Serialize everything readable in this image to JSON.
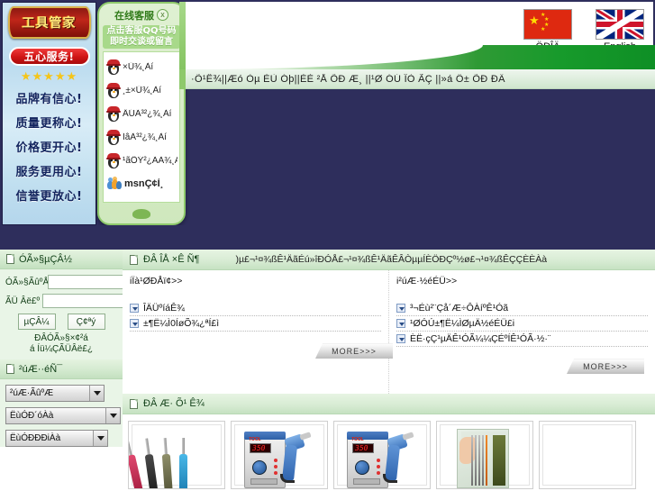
{
  "left_banner": {
    "logo_text": "工具管家",
    "badge_text": "五心服务!",
    "stars": "★★★★★",
    "slogans": [
      "品牌有信心!",
      "质量更称心!",
      "价格更开心!",
      "服务更用心!",
      "信誉更放心!"
    ]
  },
  "qq_popup": {
    "title": "在线客服",
    "close_label": "x",
    "subtitle_line1": "点击客服QQ号码",
    "subtitle_line2": "即时交谈或留言",
    "items": [
      {
        "icon": "qq-penguin-icon",
        "label": "×Ū¾¸Àí"
      },
      {
        "icon": "qq-penguin-icon",
        "label": "¸±×Ū¾¸Àí"
      },
      {
        "icon": "qq-penguin-icon",
        "label": "ÄÚÃ³²¿¾¸Àí"
      },
      {
        "icon": "qq-penguin-icon",
        "label": "ÍâÃ³²¿¾¸Àí"
      },
      {
        "icon": "qq-penguin-icon",
        "label": "¹ãÖÝ²¿ÃÃ¾¸Àí"
      },
      {
        "icon": "msn-icon",
        "label": "msnÇ¢Ì¸"
      }
    ]
  },
  "header": {
    "languages": [
      {
        "flag": "cn-flag-icon",
        "label": "ÖÐÎÄ"
      },
      {
        "flag": "uk-flag-icon",
        "label": "English"
      }
    ],
    "nav_marquee": "·Õ¹Ê¾||Æó Òµ ÈÙ Óþ||ÈÈ ²Å ÕÐ Æ¸ ||¹Ø ÓÚ ÎÒ ÃÇ ||»á Ô± ÕÐ ÐÄ"
  },
  "sidebar": {
    "login_panel": {
      "title": "ÓÃ»§µÇÂ½",
      "username_label": "ÓÃ»§ÃûºÅ",
      "username_value": "",
      "password_label": "ÃÜ Âë£º",
      "password_value": "",
      "login_button": "µÇÂ¼",
      "register_button": "Ç¢ªý",
      "hint_line1": "ÐÂÓÃ»§×¢²á",
      "hint_line2": "á Íü¼ÇÃÜÂë£¿"
    },
    "search_panel": {
      "title": "²úÆ··éÑ¯",
      "selects": [
        {
          "name": "category-select",
          "value": "²úÆ·ÃûºÆ"
        },
        {
          "name": "series-select",
          "value": "ËùÓÐ´óÀà"
        },
        {
          "name": "subcategory-select",
          "value": "ËùÓÐÐÐiÀà"
        }
      ]
    }
  },
  "content": {
    "header": {
      "title": "ÐÂ ÎÅ ×Ê Ñ¶",
      "scroll_message": ")µ£¬¹¤¾ßÊ¹ÄãÉú»îÐÓÅ£¬¹¤¾ßÊ¹ÄãÊÂÒµµÍÈÖÐÇº½ø£¬¹¤¾ßÊÇÇÈÈÀà"
    },
    "news_left": {
      "heading": "iÏà¹ØÐÅï¢>>",
      "items": [
        "ÎÄÜºíáÊ¾",
        "±¶Ë¼Ì0ÍøÕ¾¿ªÍ£ì"
      ]
    },
    "news_right": {
      "heading": "i²úÆ·½éÉÜ>>",
      "items": [
        "³¬Éù²¨Çå´Æ÷ÔÀíºÊ¹Óã",
        "¹ØÓÚ±¶Ë¼ÌØµÄ½éÉÜ£i",
        "ÈË·çÇ¹µÄÊ¹ÓÃ¼¼ÇÉºÍÊ¹ÓÃ·½·¨"
      ]
    },
    "more_button": "MORE>>>",
    "products": {
      "title": "ÐÂ Æ· Õ¹ Ê¾",
      "items": [
        {
          "art": "screwdriver-set"
        },
        {
          "art": "rework-station"
        },
        {
          "art": "rework-station"
        },
        {
          "art": "soldering-tip-card"
        },
        {
          "art": "empty"
        }
      ]
    }
  },
  "colors": {
    "page_bg": "#2e2e5c",
    "green_accent": "#179a2b",
    "panel_green": "#e9f5e7",
    "cn_flag_red": "#de2910",
    "uk_flag_blue": "#00247d"
  }
}
